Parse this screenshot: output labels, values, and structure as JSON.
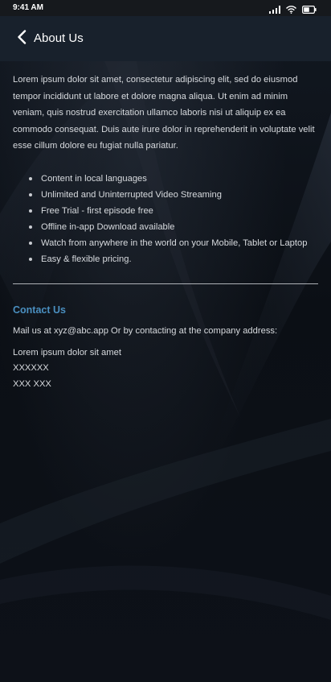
{
  "status_bar": {
    "time": "9:41 AM",
    "icons": [
      "signal-icon",
      "wifi-icon",
      "battery-icon"
    ]
  },
  "header": {
    "back_icon": "chevron-left-icon",
    "title": "About Us"
  },
  "intro": "Lorem ipsum dolor sit amet, consectetur adipiscing elit, sed do eiusmod tempor incididunt ut labore et dolore magna aliqua. Ut enim ad minim veniam, quis nostrud exercitation ullamco laboris nisi ut aliquip ex ea commodo consequat. Duis aute irure dolor in reprehenderit in voluptate velit esse cillum dolore eu fugiat nulla pariatur.",
  "features": [
    "Content in local languages",
    "Unlimited and Uninterrupted Video Streaming",
    "Free Trial - first episode free",
    "Offline in-app Download available",
    "Watch from anywhere in the world on your Mobile, Tablet or Laptop",
    "Easy & flexible pricing."
  ],
  "contact": {
    "title": "Contact Us",
    "mail_text": "Mail us at xyz@abc.app Or by contacting at the company address:",
    "address_lines": [
      "Lorem ipsum dolor sit amet",
      "XXXXXX",
      "XXX XXX"
    ]
  },
  "colors": {
    "accent": "#4a8fc0",
    "header_bg": "#18212c",
    "status_bar_bg": "#16191d",
    "page_bg": "#0b0f15"
  }
}
